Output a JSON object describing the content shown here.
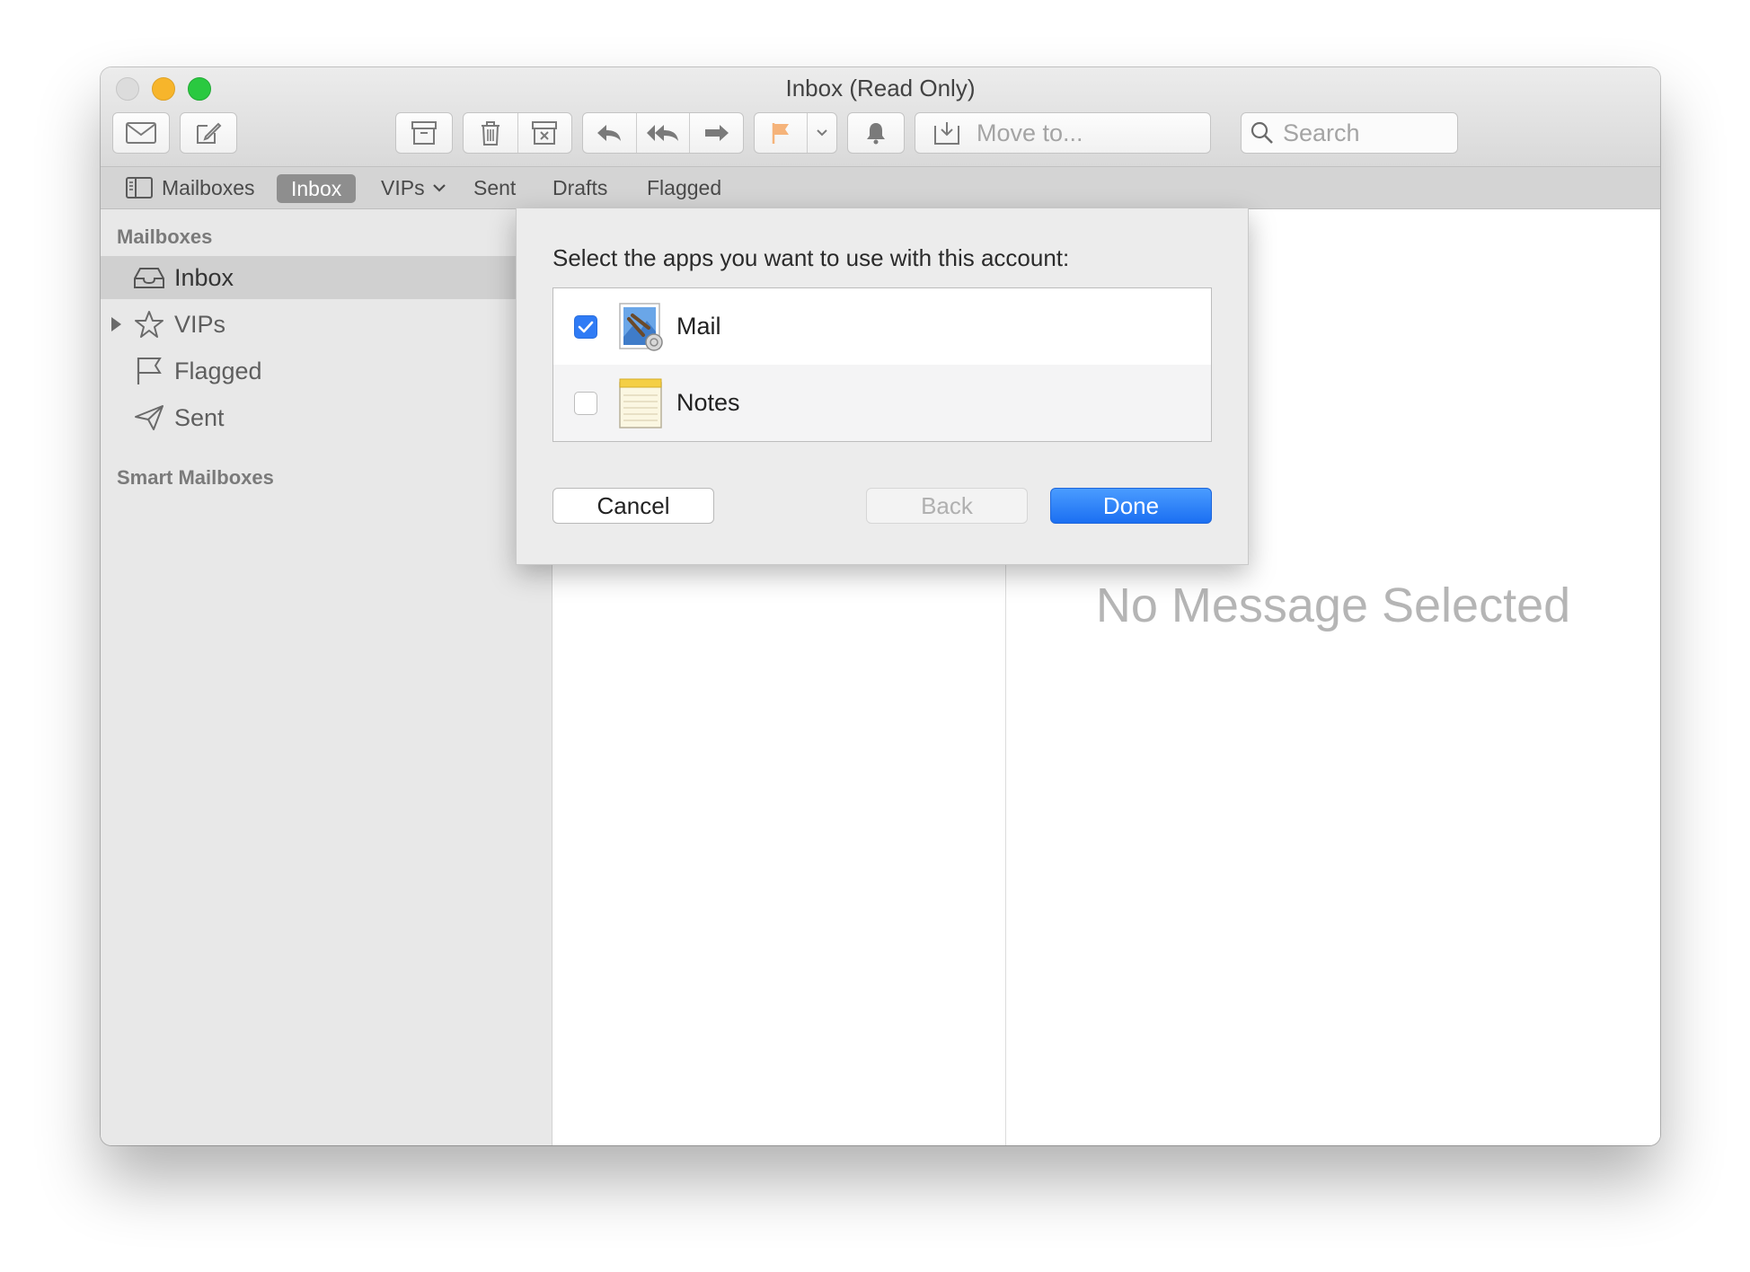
{
  "window": {
    "title": "Inbox (Read Only)"
  },
  "toolbar": {
    "move_to_label": "Move to...",
    "search_placeholder": "Search"
  },
  "favorites": {
    "mailboxes": "Mailboxes",
    "inbox": "Inbox",
    "vips": "VIPs",
    "sent": "Sent",
    "drafts": "Drafts",
    "flagged": "Flagged"
  },
  "sidebar": {
    "section_mailboxes": "Mailboxes",
    "items": [
      {
        "label": "Inbox",
        "icon": "inbox-tray-icon"
      },
      {
        "label": "VIPs",
        "icon": "star-icon"
      },
      {
        "label": "Flagged",
        "icon": "flag-icon"
      },
      {
        "label": "Sent",
        "icon": "paper-plane-icon"
      }
    ],
    "section_smart": "Smart Mailboxes"
  },
  "viewer": {
    "empty_text": "No Message Selected"
  },
  "sheet": {
    "prompt": "Select the apps you want to use with this account:",
    "apps": [
      {
        "name": "Mail",
        "checked": true,
        "icon": "mail-app-icon"
      },
      {
        "name": "Notes",
        "checked": false,
        "icon": "notes-app-icon"
      }
    ],
    "cancel_label": "Cancel",
    "back_label": "Back",
    "done_label": "Done"
  },
  "colors": {
    "accent": "#2f7bf5",
    "done_button": "#1b6ff2",
    "close_light": "#dcdcdc",
    "minimize_light": "#f7b52b",
    "zoom_light": "#2ac940",
    "flag": "#f5b37a"
  }
}
